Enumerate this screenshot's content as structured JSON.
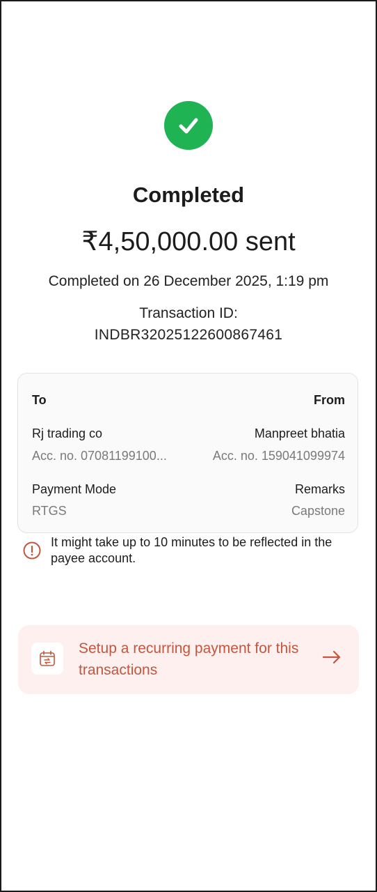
{
  "status": {
    "title": "Completed",
    "amount": "₹4,50,000.00 sent",
    "completed_on": "Completed on 26 December 2025, 1:19 pm",
    "transaction_id_label": "Transaction ID:",
    "transaction_id": "INDBR32025122600867461"
  },
  "details": {
    "to_label": "To",
    "from_label": "From",
    "to_name": "Rj trading co",
    "to_account": "Acc. no. 07081199100...",
    "from_name": "Manpreet bhatia",
    "from_account": "Acc. no. 159041099974",
    "payment_mode_label": "Payment Mode",
    "payment_mode": "RTGS",
    "remarks_label": "Remarks",
    "remarks": "Capstone"
  },
  "info": {
    "text": "It might take up to 10 minutes to be reflected in the payee account."
  },
  "recurring": {
    "text": "Setup a recurring payment for this transactions"
  },
  "icons": {
    "success": "check-circle-icon",
    "info": "info-icon",
    "calendar": "calendar-repeat-icon",
    "arrow": "arrow-right-icon"
  },
  "colors": {
    "success": "#1fb354",
    "accent": "#c2563f",
    "banner_bg": "#fdf0ee"
  }
}
